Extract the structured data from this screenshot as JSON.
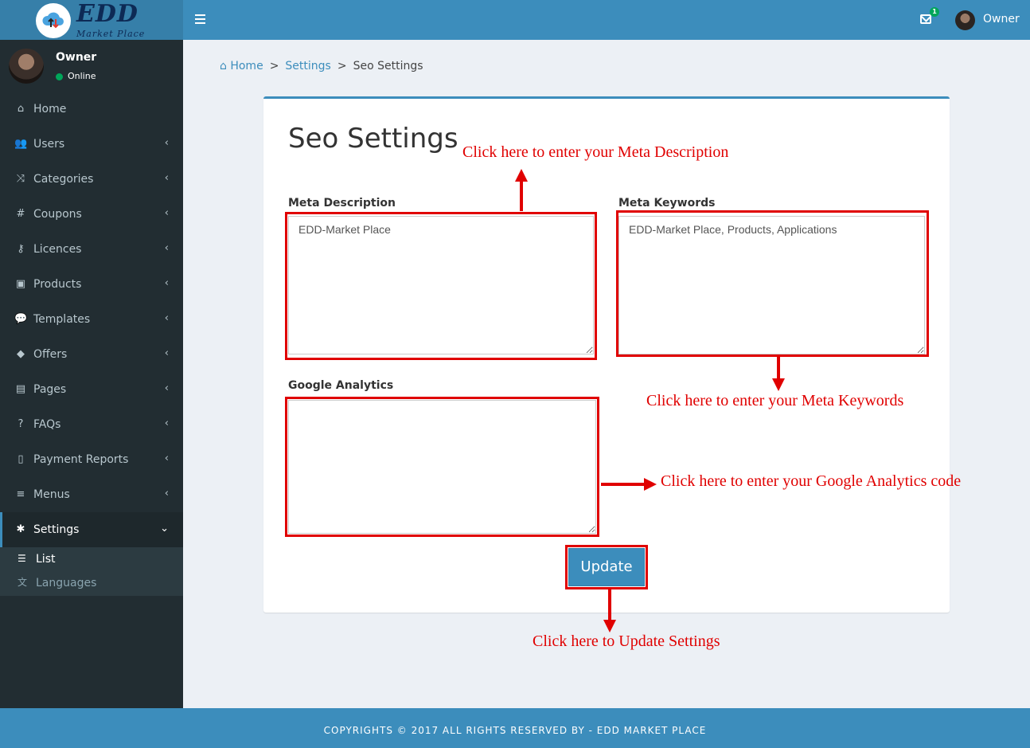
{
  "header": {
    "logo_title": "EDD",
    "logo_subtitle": "Market Place",
    "mail_badge": "1",
    "username": "Owner",
    "menu_icon": "hamburger-icon",
    "mail_icon": "envelope-icon"
  },
  "sidebar": {
    "user": {
      "name": "Owner",
      "status": "Online"
    },
    "items": [
      {
        "label": "Home",
        "icon": "home-icon",
        "glyph": "⌂",
        "chevron": ""
      },
      {
        "label": "Users",
        "icon": "users-icon",
        "glyph": "👥",
        "chevron": "‹"
      },
      {
        "label": "Categories",
        "icon": "random-icon",
        "glyph": "⤨",
        "chevron": "‹"
      },
      {
        "label": "Coupons",
        "icon": "hashtag-icon",
        "glyph": "#",
        "chevron": "‹"
      },
      {
        "label": "Licences",
        "icon": "key-icon",
        "glyph": "⚷",
        "chevron": "‹"
      },
      {
        "label": "Products",
        "icon": "shopping-bag-icon",
        "glyph": "▣",
        "chevron": "‹"
      },
      {
        "label": "Templates",
        "icon": "comment-icon",
        "glyph": "💬",
        "chevron": "‹"
      },
      {
        "label": "Offers",
        "icon": "tags-icon",
        "glyph": "◆",
        "chevron": "‹"
      },
      {
        "label": "Pages",
        "icon": "file-text-icon",
        "glyph": "▤",
        "chevron": "‹"
      },
      {
        "label": "FAQs",
        "icon": "question-icon",
        "glyph": "?",
        "chevron": "‹"
      },
      {
        "label": "Payment Reports",
        "icon": "file-icon",
        "glyph": "▯",
        "chevron": "‹"
      },
      {
        "label": "Menus",
        "icon": "bars-icon",
        "glyph": "≡",
        "chevron": "‹"
      },
      {
        "label": "Settings",
        "icon": "cog-icon",
        "glyph": "✱",
        "chevron": "⌄"
      }
    ],
    "submenu": [
      {
        "label": "List",
        "icon": "list-icon",
        "glyph": "☰"
      },
      {
        "label": "Languages",
        "icon": "language-icon",
        "glyph": "文"
      }
    ]
  },
  "breadcrumb": {
    "home": "Home",
    "settings": "Settings",
    "current": "Seo Settings",
    "separator": ">"
  },
  "form": {
    "title": "Seo Settings",
    "meta_description_label": "Meta Description",
    "meta_description_value": "EDD-Market Place",
    "meta_keywords_label": "Meta Keywords",
    "meta_keywords_value": "EDD-Market Place, Products, Applications",
    "google_analytics_label": "Google Analytics",
    "google_analytics_value": "",
    "update_label": "Update"
  },
  "annotations": {
    "meta_description": "Click here to enter your Meta Description",
    "meta_keywords": "Click here to enter your Meta Keywords",
    "google_analytics": "Click here to enter your Google Analytics code",
    "update": "Click here to Update Settings",
    "color": "#e00000"
  },
  "footer": {
    "text": "COPYRIGHTS © 2017 ALL RIGHTS RESERVED BY - EDD MARKET PLACE"
  },
  "colors": {
    "topbar": "#3c8dbc",
    "logo_bg": "#367fa9",
    "sidebar": "#222d32",
    "content_bg": "#ecf0f5",
    "accent": "#3c8dbc"
  }
}
